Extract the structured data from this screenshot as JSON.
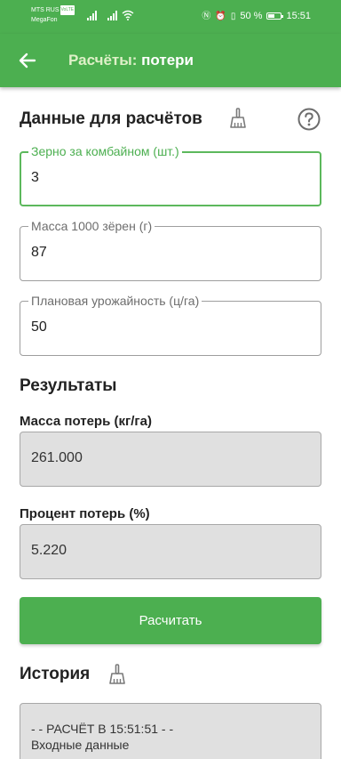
{
  "status_bar": {
    "carrier1": "MTS RUS",
    "carrier1_badge": "VoLTE",
    "carrier2": "MegaFon",
    "battery": "50 %",
    "time": "15:51"
  },
  "app_bar": {
    "title_part1": "Расчёты:",
    "title_part2": "потери",
    "back_icon": "arrow-left-icon"
  },
  "input_section": {
    "title": "Данные для расчётов",
    "clear_icon": "broom-icon",
    "help_icon": "help-circle-icon",
    "fields": [
      {
        "label": "Зерно за комбайном (шт.)",
        "value": "3"
      },
      {
        "label": "Масса 1000 зёрен (г)",
        "value": "87"
      },
      {
        "label": "Плановая урожайность (ц/га)",
        "value": "50"
      }
    ]
  },
  "results": {
    "title": "Результаты",
    "loss_mass_label": "Масса потерь (кг/га)",
    "loss_mass_value": "261.000",
    "loss_percent_label": "Процент потерь (%)",
    "loss_percent_value": "5.220"
  },
  "calculate_button": "Расчитать",
  "history": {
    "title": "История",
    "clear_icon": "broom-icon",
    "line1": "- - РАСЧЁТ В 15:51:51 - -",
    "line2": "Входные данные"
  },
  "colors": {
    "primary": "#4caf50",
    "focus_border": "#5cb85c",
    "readonly_bg": "#e0e0e0"
  }
}
